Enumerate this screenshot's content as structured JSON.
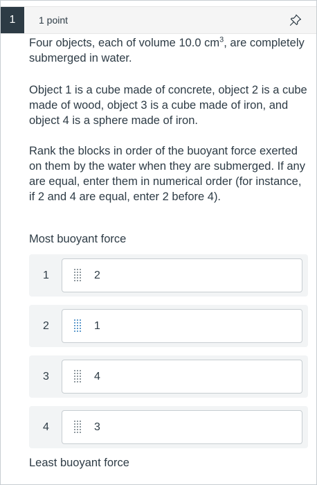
{
  "question": {
    "number": "1",
    "points": "1 point",
    "pin_icon": "pin-icon",
    "paragraph1_a": "Four objects, each of volume 10.0 cm",
    "paragraph1_sup": "3",
    "paragraph1_b": ", are completely submerged in water.",
    "paragraph2": "Object 1 is a cube made of concrete, object 2 is a cube made of wood, object 3 is a cube made of iron, and object 4 is a sphere made of iron.",
    "paragraph3": "Rank the blocks in order of the buoyant force exerted on them by the water when they are submerged. If any are equal, enter them in numerical order (for instance, if 2 and 4 are equal, enter 2 before 4)."
  },
  "ranking": {
    "top_label": "Most buoyant force",
    "bottom_label": "Least buoyant force",
    "items": [
      {
        "rank": "1",
        "value": "2",
        "handle_icon": "drag-handle-icon"
      },
      {
        "rank": "2",
        "value": "1",
        "handle_icon": "drag-handle-icon",
        "handle_color": "#2b7abc"
      },
      {
        "rank": "3",
        "value": "4",
        "handle_icon": "drag-handle-icon"
      },
      {
        "rank": "4",
        "value": "3",
        "handle_icon": "drag-handle-icon"
      }
    ]
  }
}
